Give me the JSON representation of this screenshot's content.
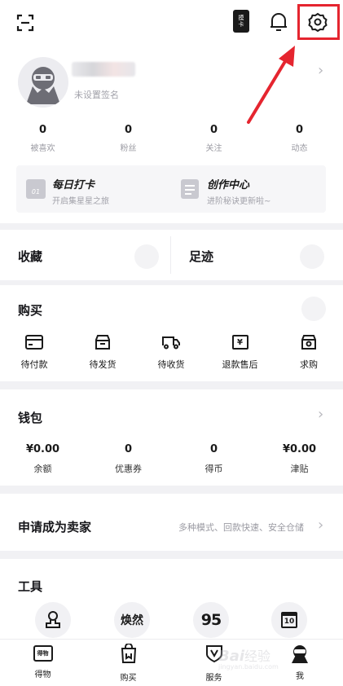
{
  "header": {
    "scan_icon": "scan-icon",
    "card_badge": "摸卡",
    "bell_icon": "bell-icon",
    "settings_icon": "gear-icon",
    "highlight_color": "#e5252f"
  },
  "profile": {
    "signature": "未设置签名",
    "stats": [
      {
        "value": "0",
        "label": "被喜欢"
      },
      {
        "value": "0",
        "label": "粉丝"
      },
      {
        "value": "0",
        "label": "关注"
      },
      {
        "value": "0",
        "label": "动态"
      }
    ]
  },
  "cards": [
    {
      "title": "每日打卡",
      "subtitle": "开启集星星之旅",
      "icon_text": "01"
    },
    {
      "title": "创作中心",
      "subtitle": "进阶秘诀更新啦~"
    }
  ],
  "favorites": {
    "collect": "收藏",
    "footprint": "足迹"
  },
  "purchase": {
    "title": "购买",
    "items": [
      {
        "label": "待付款",
        "icon": "card-icon"
      },
      {
        "label": "待发货",
        "icon": "box-icon"
      },
      {
        "label": "待收货",
        "icon": "truck-icon"
      },
      {
        "label": "退款售后",
        "icon": "refund-icon",
        "glyph": "¥"
      },
      {
        "label": "求购",
        "icon": "bag-icon"
      }
    ]
  },
  "wallet": {
    "title": "钱包",
    "items": [
      {
        "value": "¥0.00",
        "label": "余额"
      },
      {
        "value": "0",
        "label": "优惠券"
      },
      {
        "value": "0",
        "label": "得币"
      },
      {
        "value": "¥0.00",
        "label": "津贴"
      }
    ]
  },
  "seller": {
    "title": "申请成为卖家",
    "desc": "多种模式、回款快速、安全仓储"
  },
  "tools": {
    "title": "工具",
    "items": [
      {
        "icon": "stamp-icon"
      },
      {
        "icon": "huanran-icon",
        "text": "焕然"
      },
      {
        "icon": "95-icon",
        "text": "95"
      },
      {
        "icon": "calendar-icon",
        "text": "10"
      }
    ]
  },
  "tabbar": {
    "items": [
      {
        "label": "得物",
        "icon": "dewu-icon",
        "glyph": "得物"
      },
      {
        "label": "购买",
        "icon": "shopping-bag-icon",
        "glyph": "口"
      },
      {
        "label": "服务",
        "icon": "shield-icon",
        "glyph": "V"
      },
      {
        "label": "我",
        "icon": "me-avatar-icon"
      }
    ]
  },
  "watermark": {
    "brand": "Bai",
    "brand2": "经验",
    "url": "jingyan.baidu.com"
  }
}
